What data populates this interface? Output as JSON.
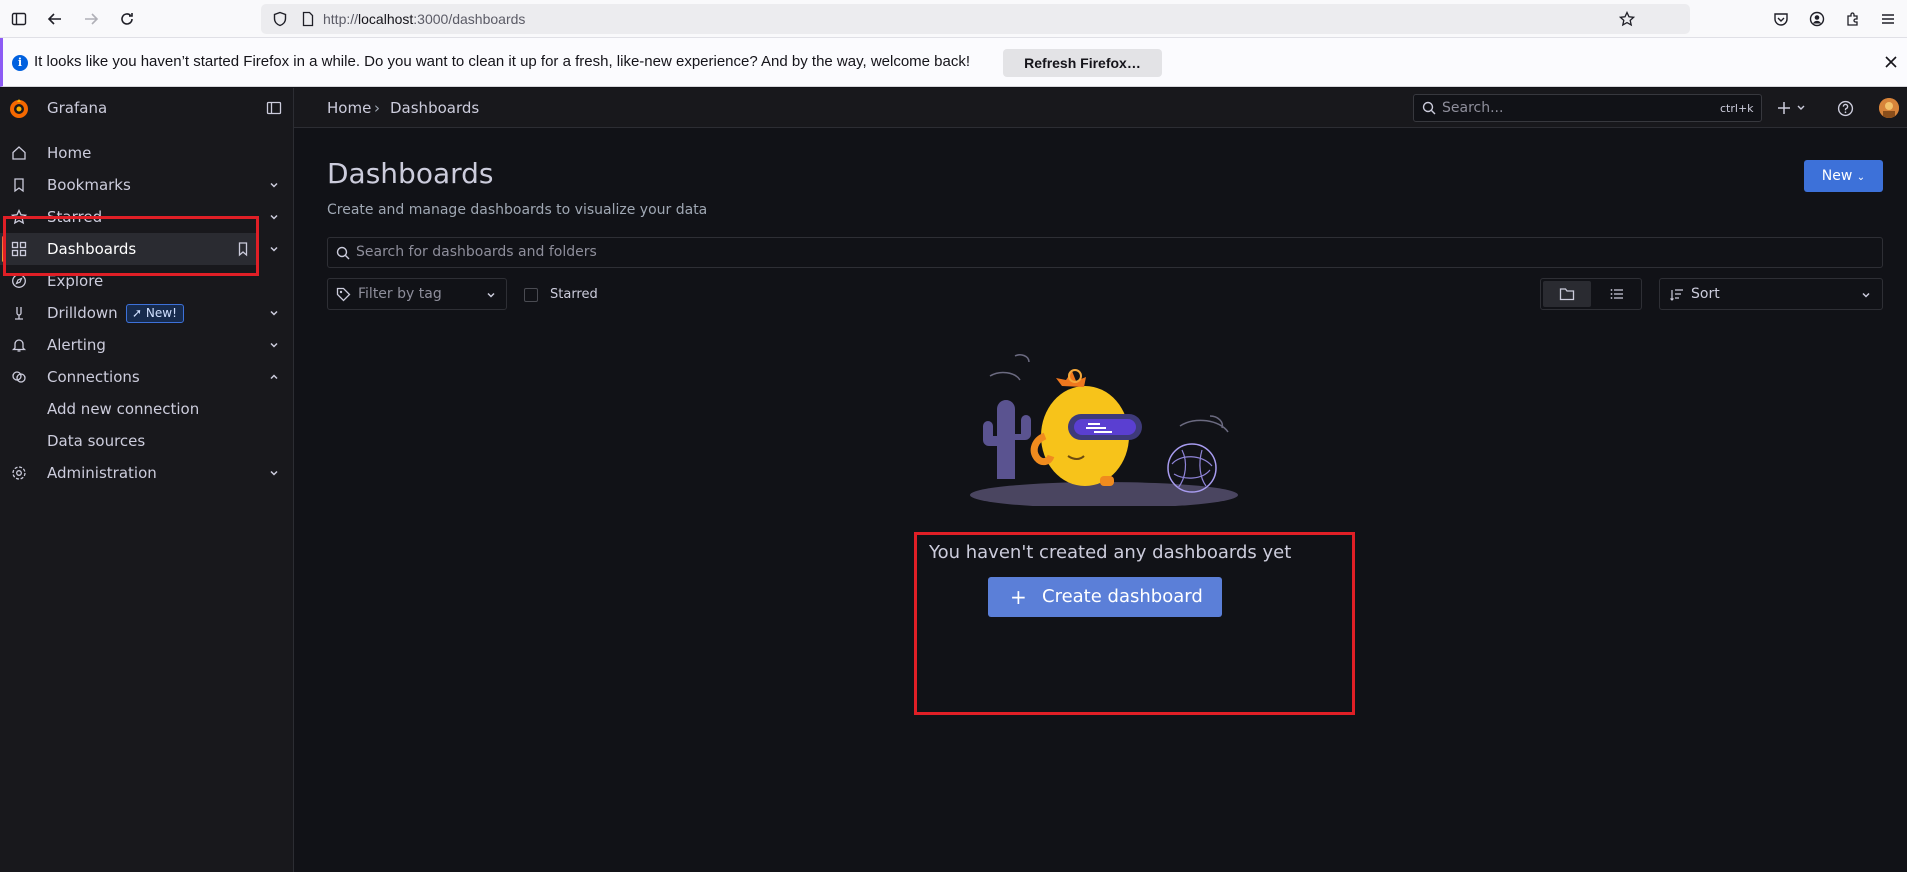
{
  "browser": {
    "url_prefix": "http://",
    "url_host": "localhost",
    "url_rest": ":3000/dashboards"
  },
  "notification": {
    "text": "It looks like you haven’t started Firefox in a while. Do you want to clean it up for a fresh, like-new experience? And by the way, welcome back!",
    "button": "Refresh Firefox…"
  },
  "app": {
    "name": "Grafana"
  },
  "sidebar": {
    "items": [
      {
        "label": "Home",
        "icon": "home-icon"
      },
      {
        "label": "Bookmarks",
        "icon": "bookmark-icon"
      },
      {
        "label": "Starred",
        "icon": "star-icon"
      },
      {
        "label": "Dashboards",
        "icon": "apps-icon"
      },
      {
        "label": "Explore",
        "icon": "compass-icon"
      },
      {
        "label": "Drilldown",
        "icon": "drilldown-icon",
        "badge": "New!"
      },
      {
        "label": "Alerting",
        "icon": "bell-icon"
      },
      {
        "label": "Connections",
        "icon": "link-icon"
      },
      {
        "label": "Add new connection"
      },
      {
        "label": "Data sources"
      },
      {
        "label": "Administration",
        "icon": "cog-icon"
      }
    ]
  },
  "breadcrumb": {
    "home": "Home",
    "sep": "›",
    "current": "Dashboards"
  },
  "topbar": {
    "search_placeholder": "Search...",
    "shortcut": "ctrl+k"
  },
  "main": {
    "title": "Dashboards",
    "subtitle": "Create and manage dashboards to visualize your data",
    "new_button": "New",
    "search_placeholder": "Search for dashboards and folders",
    "tag_filter_placeholder": "Filter by tag",
    "starred_label": "Starred",
    "sort_label": "Sort",
    "empty_message": "You haven't created any dashboards yet",
    "create_button": "Create dashboard"
  },
  "colors": {
    "accent": "#3d71d9",
    "highlight_box": "#e01f26",
    "background": "#111217"
  }
}
